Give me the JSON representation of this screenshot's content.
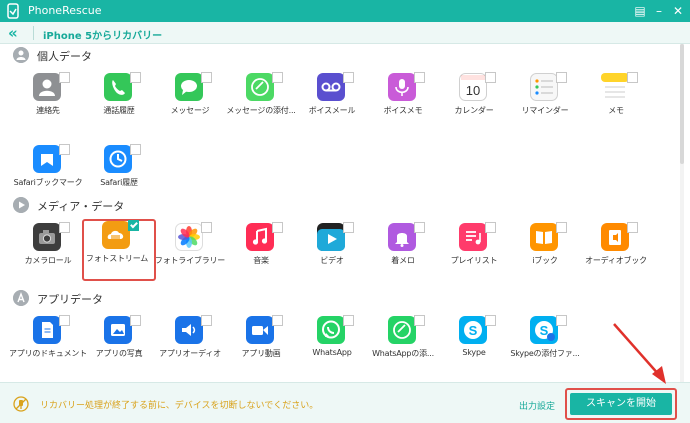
{
  "app": {
    "title": "PhoneRescue"
  },
  "nav": {
    "title": "iPhone 5からリカバリー"
  },
  "sections": [
    {
      "title": "個人データ",
      "icon": "person-icon",
      "items": [
        {
          "label": "連絡先",
          "icon": "contacts-icon",
          "color": "#8e9093"
        },
        {
          "label": "通話履歴",
          "icon": "phone-icon",
          "color": "#34c759"
        },
        {
          "label": "メッセージ",
          "icon": "message-icon",
          "color": "#34c759"
        },
        {
          "label": "メッセージの添付...",
          "icon": "message-attachment-icon",
          "color": "#4cd964"
        },
        {
          "label": "ボイスメール",
          "icon": "voicemail-icon",
          "color": "#5a4fcf"
        },
        {
          "label": "ボイスメモ",
          "icon": "voice-memo-icon",
          "color": "#c95bd8"
        },
        {
          "label": "カレンダー",
          "icon": "calendar-icon",
          "color": "#ffffff",
          "text": "10"
        },
        {
          "label": "リマインダー",
          "icon": "reminders-icon",
          "color": "#f2f2f2"
        },
        {
          "label": "メモ",
          "icon": "notes-icon",
          "color": "#ffd42a"
        },
        {
          "label": "Safariブックマーク",
          "icon": "safari-bookmark-icon",
          "color": "#1a8cff"
        },
        {
          "label": "Safari履歴",
          "icon": "safari-history-icon",
          "color": "#1a8cff"
        }
      ]
    },
    {
      "title": "メディア・データ",
      "icon": "play-icon",
      "items": [
        {
          "label": "カメラロール",
          "icon": "camera-icon",
          "color": "#3d3d3d"
        },
        {
          "label": "フォトストリーム",
          "icon": "photostream-icon",
          "color": "#f39c12",
          "selected": true
        },
        {
          "label": "フォトライブラリー",
          "icon": "photos-icon",
          "color": "#ffffff"
        },
        {
          "label": "音楽",
          "icon": "music-icon",
          "color": "#ff2d55"
        },
        {
          "label": "ビデオ",
          "icon": "video-icon",
          "color": "#1fa9d9"
        },
        {
          "label": "着メロ",
          "icon": "ringtone-icon",
          "color": "#b05ae0"
        },
        {
          "label": "プレイリスト",
          "icon": "playlist-icon",
          "color": "#ff3b6b"
        },
        {
          "label": "iブック",
          "icon": "ibooks-icon",
          "color": "#ff9500"
        },
        {
          "label": "オーディオブック",
          "icon": "audiobook-icon",
          "color": "#ff8a00"
        }
      ]
    },
    {
      "title": "アプリデータ",
      "icon": "appstore-icon",
      "items": [
        {
          "label": "アプリのドキュメント",
          "icon": "app-document-icon",
          "color": "#1a73e8"
        },
        {
          "label": "アプリの写真",
          "icon": "app-photo-icon",
          "color": "#1a73e8"
        },
        {
          "label": "アプリオーディオ",
          "icon": "app-audio-icon",
          "color": "#1a73e8"
        },
        {
          "label": "アプリ動画",
          "icon": "app-video-icon",
          "color": "#1a73e8"
        },
        {
          "label": "WhatsApp",
          "icon": "whatsapp-icon",
          "color": "#25d366"
        },
        {
          "label": "WhatsAppの添...",
          "icon": "whatsapp-attachment-icon",
          "color": "#25d366"
        },
        {
          "label": "Skype",
          "icon": "skype-icon",
          "color": "#00aff0"
        },
        {
          "label": "Skypeの添付ファ...",
          "icon": "skype-attachment-icon",
          "color": "#00aff0"
        }
      ]
    }
  ],
  "footer": {
    "warning": "リカバリー処理が終了する前に、デバイスを切断しないでください。",
    "output_settings": "出力設定",
    "scan_button": "スキャンを開始"
  }
}
